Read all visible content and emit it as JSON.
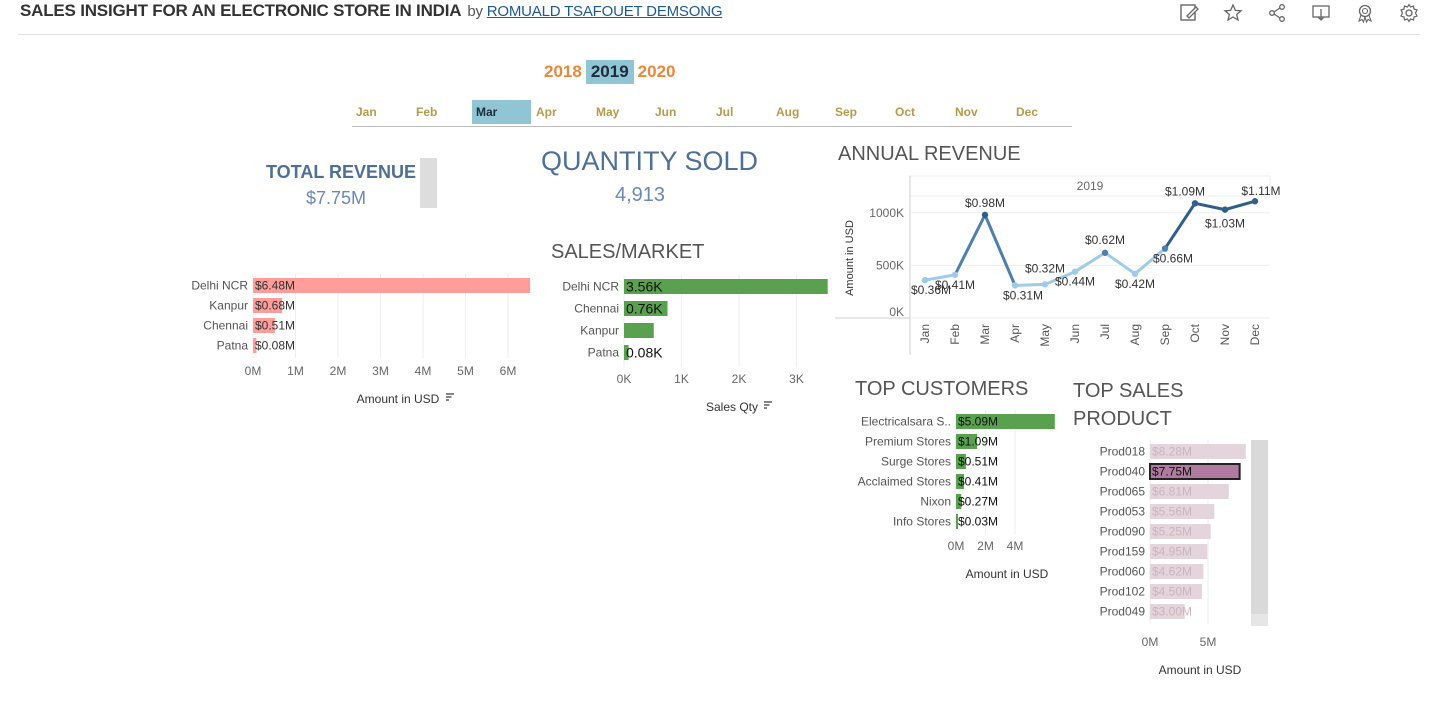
{
  "header": {
    "title": "SALES INSIGHT FOR AN ELECTRONIC STORE IN INDIA",
    "by": "by",
    "author": "ROMUALD TSAFOUET DEMSONG",
    "icons": [
      "edit-icon",
      "star-icon",
      "share-icon",
      "download-icon",
      "badge-icon",
      "settings-icon"
    ]
  },
  "filters": {
    "years": [
      "2018",
      "2019",
      "2020"
    ],
    "selected_year": "2019",
    "months": [
      "Jan",
      "Feb",
      "Mar",
      "Apr",
      "May",
      "Jun",
      "Jul",
      "Aug",
      "Sep",
      "Oct",
      "Nov",
      "Dec"
    ],
    "selected_month": "Mar"
  },
  "kpis": {
    "total_revenue_label": "TOTAL REVENUE",
    "total_revenue_value": "$7.75M",
    "quantity_sold_label": "QUANTITY SOLD",
    "quantity_sold_value": "4,913"
  },
  "sections": {
    "sales_market": "SALES/MARKET",
    "annual_revenue": "ANNUAL REVENUE",
    "top_customers": "TOP CUSTOMERS",
    "top_sales_product_1": "TOP SALES",
    "top_sales_product_2": "PRODUCT"
  },
  "colors": {
    "revenue_bar": "#ff9d9a",
    "qty_bar": "#59a14f",
    "line_light": "#a0cbe8",
    "line_dark": "#2f5f8a",
    "product_bar": "#e4d4dc",
    "product_selected": "#b07aa1",
    "year_accent": "#e8883a",
    "selected_bg": "#8fc5d4"
  },
  "chart_data": [
    {
      "type": "bar",
      "id": "revenue_by_market",
      "categories": [
        "Delhi NCR",
        "Kanpur",
        "Chennai",
        "Patna"
      ],
      "values": [
        6.48,
        0.68,
        0.51,
        0.08
      ],
      "labels": [
        "$6.48M",
        "$0.68M",
        "$0.51M",
        "$0.08M"
      ],
      "ticks": [
        "0M",
        "1M",
        "2M",
        "3M",
        "4M",
        "5M",
        "6M"
      ],
      "xlim": [
        0,
        6.5
      ],
      "xlabel": "Amount in USD"
    },
    {
      "type": "bar",
      "id": "qty_by_market",
      "categories": [
        "Delhi NCR",
        "Chennai",
        "Kanpur",
        "Patna"
      ],
      "values": [
        3.56,
        0.76,
        0.52,
        0.08
      ],
      "labels": [
        "3.56K",
        "0.76K",
        "",
        "0.08K"
      ],
      "ticks": [
        "0K",
        "1K",
        "2K",
        "3K"
      ],
      "xlim": [
        0,
        3.6
      ],
      "xlabel": "Sales Qty"
    },
    {
      "type": "line",
      "id": "annual_revenue",
      "panel": "2019",
      "x": [
        "Jan",
        "Feb",
        "Mar",
        "Apr",
        "May",
        "Jun",
        "Jul",
        "Aug",
        "Sep",
        "Oct",
        "Nov",
        "Dec"
      ],
      "values": [
        0.36,
        0.41,
        0.98,
        0.31,
        0.32,
        0.44,
        0.62,
        0.42,
        0.66,
        1.09,
        1.03,
        1.11
      ],
      "labels": [
        "$0.36M",
        "$0.41M",
        "$0.98M",
        "$0.31M",
        "$0.32M",
        "$0.44M",
        "$0.62M",
        "$0.42M",
        "$0.66M",
        "$1.09M",
        "$1.03M",
        "$1.11M"
      ],
      "yticks": [
        "0K",
        "500K",
        "1000K"
      ],
      "ylim": [
        0,
        1.15
      ],
      "ylabel": "Amount in USD"
    },
    {
      "type": "bar",
      "id": "top_customers",
      "categories": [
        "Electricalsara S..",
        "Premium Stores",
        "Surge Stores",
        "Acclaimed Stores",
        "Nixon",
        "Info Stores"
      ],
      "values": [
        5.09,
        1.09,
        0.51,
        0.41,
        0.27,
        0.03
      ],
      "labels": [
        "$5.09M",
        "$1.09M",
        "$0.51M",
        "$0.41M",
        "$0.27M",
        "$0.03M"
      ],
      "ticks": [
        "0M",
        "2M",
        "4M"
      ],
      "xlim": [
        0,
        5.1
      ],
      "xlabel": "Amount in USD"
    },
    {
      "type": "bar",
      "id": "top_products",
      "categories": [
        "Prod018",
        "Prod040",
        "Prod065",
        "Prod053",
        "Prod090",
        "Prod159",
        "Prod060",
        "Prod102",
        "Prod049"
      ],
      "values": [
        8.28,
        7.75,
        6.81,
        5.56,
        5.25,
        4.95,
        4.62,
        4.5,
        3.0
      ],
      "labels": [
        "$8.28M",
        "$7.75M",
        "$6.81M",
        "$5.56M",
        "$5.25M",
        "$4.95M",
        "$4.62M",
        "$4.50M",
        "$3.00M"
      ],
      "selected": "Prod040",
      "ticks": [
        "0M",
        "5M"
      ],
      "xlim": [
        0,
        8.3
      ],
      "xlabel": "Amount in USD"
    }
  ]
}
